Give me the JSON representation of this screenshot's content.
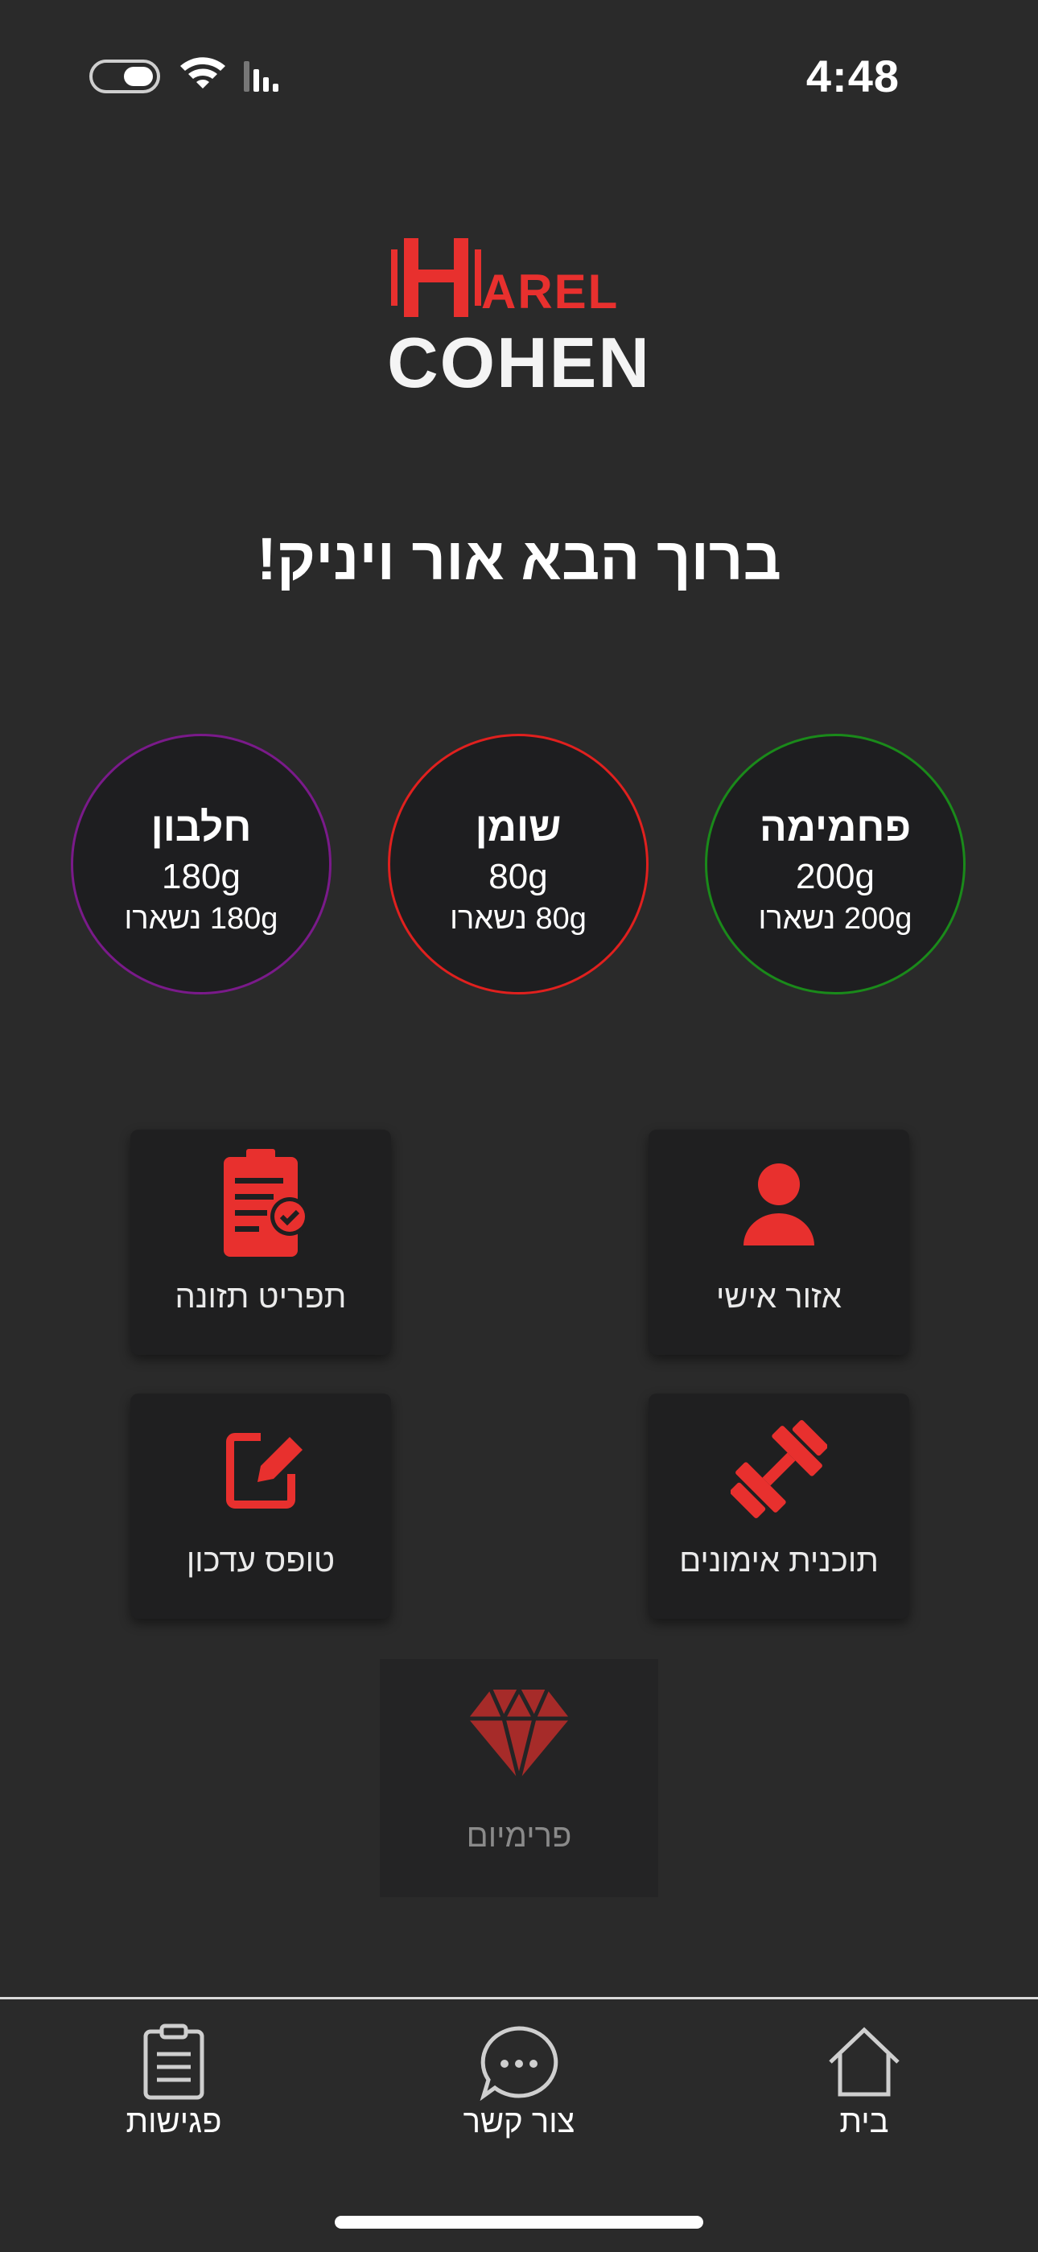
{
  "status_bar": {
    "time": "4:48"
  },
  "logo": {
    "line1": "AREL",
    "line2": "COHEN"
  },
  "welcome": "ברוך הבא אור ויניק!",
  "macros": [
    {
      "name": "פחמימה",
      "amount": "200g",
      "remaining": "200g נשארו",
      "color": "#1a8a1a"
    },
    {
      "name": "שומן",
      "amount": "80g",
      "remaining": "80g נשארו",
      "color": "#e0201e"
    },
    {
      "name": "חלבון",
      "amount": "180g",
      "remaining": "180g נשארו",
      "color": "#7a1a8a"
    }
  ],
  "tiles": {
    "personal": "אזור אישי",
    "menu": "תפריט תזונה",
    "workout": "תוכנית אימונים",
    "update": "טופס עדכון",
    "premium": "פרימיום"
  },
  "nav": {
    "home": "בית",
    "contact": "צור קשר",
    "meetings": "פגישות"
  },
  "colors": {
    "accent": "#e8302e",
    "background": "#2a2a2a",
    "tile": "#1f1f20"
  }
}
